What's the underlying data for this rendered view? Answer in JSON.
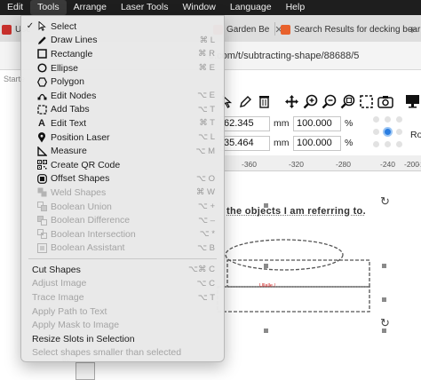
{
  "menubar": {
    "items": [
      "Edit",
      "Tools",
      "Arrange",
      "Laser Tools",
      "Window",
      "Language",
      "Help"
    ],
    "active_index": 1
  },
  "browser": {
    "tabs": [
      {
        "label": "Use",
        "favicon_color": "#c8302c"
      },
      {
        "label": "Garden Be",
        "favicon_color": "#c8302c"
      },
      {
        "label": "Search Results for decking boar",
        "favicon_color": "#e8612c"
      }
    ],
    "url_text": "e.com/t/subtracting-shape/88688/5",
    "side_text": "Starte"
  },
  "toolbar": {
    "icons": [
      "cursor-icon",
      "pen-icon",
      "trash-icon",
      "move-icon",
      "zoom-in-icon",
      "zoom-out-icon",
      "zoom-fit-icon",
      "frame-select-icon",
      "camera-icon",
      "monitor-icon"
    ]
  },
  "fields": {
    "x_value": "62.345",
    "y_value": "35.464",
    "unit": "mm",
    "width_pct": "100.000",
    "height_pct": "100.000",
    "pct_symbol": "%",
    "ro_label": "Ro"
  },
  "ruler": {
    "labels": [
      "-360",
      "-320",
      "-280",
      "-240",
      "-200",
      "-1"
    ],
    "side_label": "80"
  },
  "canvas": {
    "text": "the objects I am referring to.",
    "red_label": "Ullalle /"
  },
  "tools_menu": {
    "items": [
      {
        "label": "Select",
        "shortcut": "",
        "icon": "cursor-icon",
        "checked": true,
        "disabled": false
      },
      {
        "label": "Draw Lines",
        "shortcut": "⌘ L",
        "icon": "pencil-icon",
        "checked": false,
        "disabled": false
      },
      {
        "label": "Rectangle",
        "shortcut": "⌘ R",
        "icon": "square-icon",
        "checked": false,
        "disabled": false
      },
      {
        "label": "Ellipse",
        "shortcut": "⌘ E",
        "icon": "circle-icon",
        "checked": false,
        "disabled": false
      },
      {
        "label": "Polygon",
        "shortcut": "",
        "icon": "hexagon-icon",
        "checked": false,
        "disabled": false
      },
      {
        "label": "Edit Nodes",
        "shortcut": "⌥ E",
        "icon": "nodes-icon",
        "checked": false,
        "disabled": false
      },
      {
        "label": "Add Tabs",
        "shortcut": "⌥ T",
        "icon": "tabs-icon",
        "checked": false,
        "disabled": false
      },
      {
        "label": "Edit Text",
        "shortcut": "⌘ T",
        "icon": "text-icon",
        "checked": false,
        "disabled": false
      },
      {
        "label": "Position Laser",
        "shortcut": "⌥ L",
        "icon": "pin-icon",
        "checked": false,
        "disabled": false
      },
      {
        "label": "Measure",
        "shortcut": "⌥ M",
        "icon": "measure-icon",
        "checked": false,
        "disabled": false
      },
      {
        "label": "Create QR Code",
        "shortcut": "",
        "icon": "qr-icon",
        "checked": false,
        "disabled": false
      },
      {
        "label": "Offset Shapes",
        "shortcut": "⌥ O",
        "icon": "offset-icon",
        "checked": false,
        "disabled": false
      },
      {
        "label": "Weld Shapes",
        "shortcut": "⌘ W",
        "icon": "weld-icon",
        "checked": false,
        "disabled": true
      },
      {
        "label": "Boolean Union",
        "shortcut": "⌥ +",
        "icon": "union-icon",
        "checked": false,
        "disabled": true
      },
      {
        "label": "Boolean Difference",
        "shortcut": "⌥ –",
        "icon": "difference-icon",
        "checked": false,
        "disabled": true
      },
      {
        "label": "Boolean Intersection",
        "shortcut": "⌥ *",
        "icon": "intersection-icon",
        "checked": false,
        "disabled": true
      },
      {
        "label": "Boolean Assistant",
        "shortcut": "⌥ B",
        "icon": "assistant-icon",
        "checked": false,
        "disabled": true
      }
    ],
    "items2": [
      {
        "label": "Cut Shapes",
        "shortcut": "⌥⌘ C",
        "disabled": false
      },
      {
        "label": "Adjust Image",
        "shortcut": "⌥ C",
        "disabled": true
      },
      {
        "label": "Trace Image",
        "shortcut": "⌥ T",
        "disabled": true
      },
      {
        "label": "Apply Path to Text",
        "shortcut": "",
        "disabled": true
      },
      {
        "label": "Apply Mask to Image",
        "shortcut": "",
        "disabled": true
      },
      {
        "label": "Resize Slots in Selection",
        "shortcut": "",
        "disabled": false
      },
      {
        "label": "Select shapes smaller than selected",
        "shortcut": "",
        "disabled": true
      }
    ]
  }
}
